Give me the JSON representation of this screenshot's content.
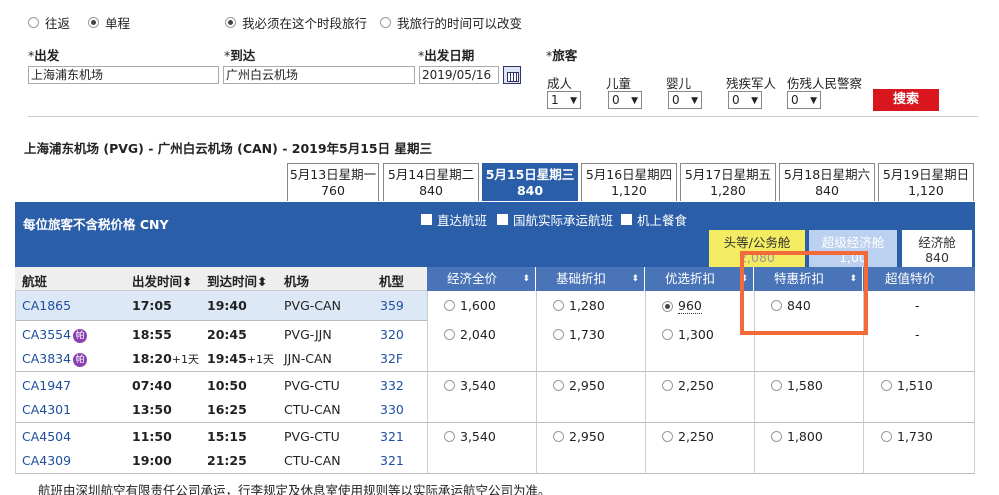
{
  "trip": {
    "roundtrip": "往返",
    "oneway": "单程",
    "fixed_time": "我必须在这个时段旅行",
    "flexible_time": "我旅行的时间可以改变"
  },
  "form": {
    "from_label": "出发",
    "to_label": "到达",
    "date_label": "出发日期",
    "pax_label": "旅客",
    "from_value": "上海浦东机场",
    "to_value": "广州白云机场",
    "date_value": "2019/05/16",
    "required_mark": "*",
    "pax": [
      {
        "label": "成人",
        "value": "1"
      },
      {
        "label": "儿童",
        "value": "0"
      },
      {
        "label": "婴儿",
        "value": "0"
      },
      {
        "label": "残疾军人",
        "value": "0"
      },
      {
        "label": "伤残人民警察",
        "value": "0"
      }
    ],
    "search": "搜索"
  },
  "route": "上海浦东机场 (PVG) - 广州白云机场 (CAN) - 2019年5月15日 星期三",
  "dates": [
    {
      "label": "5月13日星期一",
      "price": "760"
    },
    {
      "label": "5月14日星期二",
      "price": "840"
    },
    {
      "label": "5月15日星期三",
      "price": "840"
    },
    {
      "label": "5月16日星期四",
      "price": "1,120"
    },
    {
      "label": "5月17日星期五",
      "price": "1,280"
    },
    {
      "label": "5月18日星期六",
      "price": "840"
    },
    {
      "label": "5月19日星期日",
      "price": "1,120"
    }
  ],
  "band": {
    "title": "每位旅客不含税价格 CNY",
    "filters": [
      "直达航班",
      "国航实际承运航班",
      "机上餐食"
    ],
    "cabins": [
      {
        "label": "头等/公务舱",
        "price": "2,080"
      },
      {
        "label": "超级经济舱",
        "price": "1,00"
      },
      {
        "label": "经济舱",
        "price": "840"
      }
    ]
  },
  "headers": {
    "flight": "航班",
    "depart": "出发时间",
    "arrive": "到达时间",
    "airport": "机场",
    "aircraft": "机型",
    "fares": [
      "经济全价",
      "基础折扣",
      "优选折扣",
      "特惠折扣",
      "超值特价"
    ]
  },
  "sort_icon": "⬍",
  "rows": [
    {
      "legs": [
        {
          "flight": "CA1865",
          "dep": "17:05",
          "arr": "19:40",
          "apt": "PVG-CAN",
          "eq": "359"
        }
      ],
      "fares": [
        "1,600",
        "1,280",
        "960",
        "840",
        "-"
      ]
    },
    {
      "legs": [
        {
          "flight": "CA3554",
          "dep": "18:55",
          "arr": "20:45",
          "apt": "PVG-JJN",
          "eq": "320"
        },
        {
          "flight": "CA3834",
          "dep": "18:20",
          "dep_sup": "+1天",
          "arr": "19:45",
          "arr_sup": "+1天",
          "apt": "JJN-CAN",
          "eq": "32F"
        }
      ],
      "fares": [
        "2,040",
        "1,730",
        "1,300",
        "",
        "-"
      ]
    },
    {
      "legs": [
        {
          "flight": "CA1947",
          "dep": "07:40",
          "arr": "10:50",
          "apt": "PVG-CTU",
          "eq": "332"
        },
        {
          "flight": "CA4301",
          "dep": "13:50",
          "arr": "16:25",
          "apt": "CTU-CAN",
          "eq": "330"
        }
      ],
      "fares": [
        "3,540",
        "2,950",
        "2,250",
        "1,580",
        "1,510"
      ]
    },
    {
      "legs": [
        {
          "flight": "CA4504",
          "dep": "11:50",
          "arr": "15:15",
          "apt": "PVG-CTU",
          "eq": "321"
        },
        {
          "flight": "CA4309",
          "dep": "19:00",
          "arr": "21:25",
          "apt": "CTU-CAN",
          "eq": "321"
        }
      ],
      "fares": [
        "3,540",
        "2,950",
        "2,250",
        "1,800",
        "1,730"
      ]
    }
  ],
  "badge_icon": "帕",
  "footnote": "航班由深圳航空有限责任公司承运，行李规定及休息室使用规则等以实际承运航空公司为准。",
  "colors": {
    "accent": "#2b5ea8",
    "search": "#d9151e",
    "highlight": "#f26a3a",
    "badge": "#8a3fb3"
  }
}
